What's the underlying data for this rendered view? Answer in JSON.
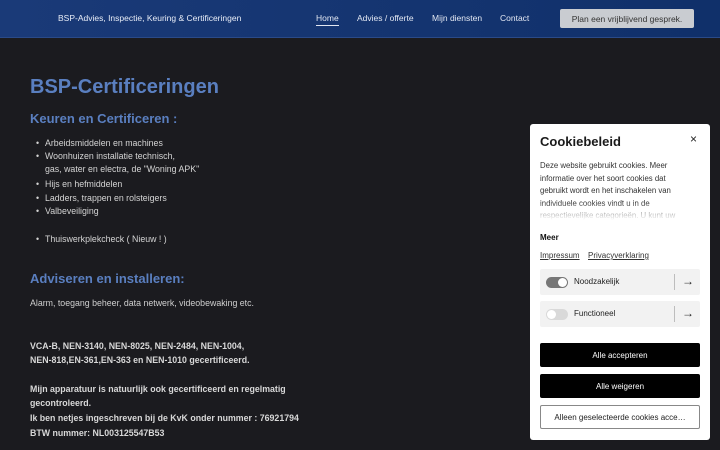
{
  "header": {
    "brand": "BSP-Advies, Inspectie, Keuring & Certificeringen",
    "nav": [
      "Home",
      "Advies / offerte",
      "Mijn diensten",
      "Contact"
    ],
    "cta": "Plan een vrijblijvend gesprek."
  },
  "main": {
    "title": "BSP-Certificeringen",
    "section1": "Keuren en Certificeren :",
    "items": [
      "Arbeidsmiddelen en machines",
      "Woonhuizen installatie technisch,",
      "gas, water en electra, de \"Woning APK\"",
      "Hijs en hefmiddelen",
      "Ladders, trappen en rolsteigers",
      "Valbeveiliging",
      "Thuiswerkplekcheck  ( Nieuw ! )"
    ],
    "section2": "Adviseren en installeren:",
    "section2_text": "Alarm, toegang beheer, data netwerk, videobewaking etc.",
    "certs_line1": "VCA-B, NEN-3140, NEN-8025, NEN-2484, NEN-1004,",
    "certs_line2": "NEN-818,EN-361,EN-363 en NEN-1010 gecertificeerd.",
    "info_line1": "Mijn apparatuur is natuurlijk ook gecertificeerd en  regelmatig",
    "info_line2": "gecontroleerd.",
    "info_line3": "Ik ben netjes ingeschreven bij de KvK onder nummer :   76921794",
    "info_line4": "BTW nummer:  NL003125547B53"
  },
  "cookie": {
    "title": "Cookiebeleid",
    "close_icon": "×",
    "description": "Deze website gebruikt cookies. Meer informatie over het soort cookies dat gebruikt wordt en het inschakelen van individuele cookies vindt u in de respectievelijke categorieën. U kunt uw",
    "more": "Meer",
    "links": [
      "Impressum",
      "Privacyverklaring"
    ],
    "categories": [
      {
        "label": "Noodzakelijk",
        "enabled": true
      },
      {
        "label": "Functioneel",
        "enabled": false
      }
    ],
    "arrow_icon": "→",
    "accept_all": "Alle accepteren",
    "reject_all": "Alle weigeren",
    "accept_selected": "Alleen geselecteerde cookies acce…"
  },
  "colors": {
    "header_bg": "#1a3a78",
    "heading_blue": "#5a7fc0",
    "page_bg": "#1b1b1f",
    "toggle_on": "#777777",
    "toggle_off": "#d9d9d9"
  }
}
